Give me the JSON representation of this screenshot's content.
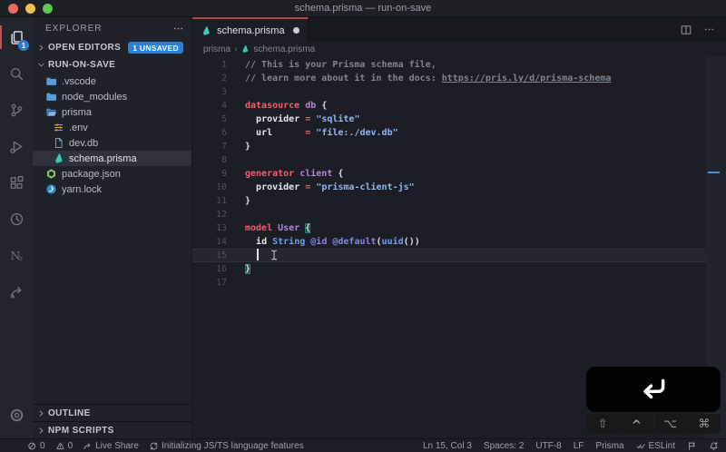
{
  "window": {
    "title": "schema.prisma — run-on-save"
  },
  "colors": {
    "tab_accent": "#b04a40",
    "activity_indicator": "#c94f44",
    "badge_blue": "#2b7fd4",
    "prisma_teal": "#3ec9b7",
    "folder_blue": "#559ddb",
    "node_green": "#8cc265",
    "yarn_blue": "#2d8ebf",
    "env_gold": "#d2a53a",
    "cursor_marker_blue": "#4f8ed4",
    "editor_bg": "#1b1e24",
    "sidebar_bg": "#1f2228",
    "statusbar_bg": "#1c1f25"
  },
  "activity_bar": {
    "items": [
      {
        "name": "explorer",
        "active": true,
        "badge": "1"
      },
      {
        "name": "search"
      },
      {
        "name": "source-control"
      },
      {
        "name": "run-debug"
      },
      {
        "name": "extensions"
      },
      {
        "name": "history-clock"
      },
      {
        "name": "n2"
      },
      {
        "name": "share-arrow"
      }
    ],
    "bottom": [
      {
        "name": "settings-gear"
      }
    ]
  },
  "sidebar": {
    "title": "EXPLORER",
    "open_editors": {
      "label": "OPEN EDITORS",
      "badge": "1 UNSAVED"
    },
    "section": "RUN-ON-SAVE",
    "files": [
      {
        "icon": "folder",
        "label": ".vscode",
        "depth": 1
      },
      {
        "icon": "folder",
        "label": "node_modules",
        "depth": 1
      },
      {
        "icon": "folder-open",
        "label": "prisma",
        "depth": 1
      },
      {
        "icon": "env",
        "label": ".env",
        "depth": 2
      },
      {
        "icon": "file",
        "label": "dev.db",
        "depth": 2
      },
      {
        "icon": "prisma",
        "label": "schema.prisma",
        "depth": 2,
        "selected": true
      },
      {
        "icon": "node",
        "label": "package.json",
        "depth": 1
      },
      {
        "icon": "yarn",
        "label": "yarn.lock",
        "depth": 1
      }
    ],
    "outline_label": "OUTLINE",
    "npm_label": "NPM SCRIPTS"
  },
  "editor": {
    "tab": {
      "name": "schema.prisma",
      "modified": true
    },
    "breadcrumb": {
      "folder": "prisma",
      "file": "schema.prisma"
    },
    "cursor": {
      "line": 15,
      "col": 3
    },
    "code": {
      "lines": [
        {
          "n": "1",
          "tokens": [
            [
              "com",
              "// This is your Prisma schema file,"
            ]
          ]
        },
        {
          "n": "2",
          "tokens": [
            [
              "com",
              "// learn more about it in the docs: "
            ],
            [
              "com-link",
              "https://pris.ly/d/prisma-schema"
            ]
          ]
        },
        {
          "n": "3",
          "tokens": []
        },
        {
          "n": "4",
          "tokens": [
            [
              "kw",
              "datasource"
            ],
            [
              "pln",
              " "
            ],
            [
              "ent",
              "db"
            ],
            [
              "pln",
              " {"
            ]
          ]
        },
        {
          "n": "5",
          "tokens": [
            [
              "pln",
              "  "
            ],
            [
              "prop",
              "provider"
            ],
            [
              "pln",
              " "
            ],
            [
              "op",
              "="
            ],
            [
              "pln",
              " "
            ],
            [
              "str",
              "\"sqlite\""
            ]
          ]
        },
        {
          "n": "6",
          "tokens": [
            [
              "pln",
              "  "
            ],
            [
              "prop",
              "url"
            ],
            [
              "pln",
              "      "
            ],
            [
              "op",
              "="
            ],
            [
              "pln",
              " "
            ],
            [
              "str",
              "\"file:./dev.db\""
            ]
          ]
        },
        {
          "n": "7",
          "tokens": [
            [
              "pln",
              "}"
            ]
          ]
        },
        {
          "n": "8",
          "tokens": []
        },
        {
          "n": "9",
          "tokens": [
            [
              "kw",
              "generator"
            ],
            [
              "pln",
              " "
            ],
            [
              "ent",
              "client"
            ],
            [
              "pln",
              " {"
            ]
          ]
        },
        {
          "n": "10",
          "tokens": [
            [
              "pln",
              "  "
            ],
            [
              "prop",
              "provider"
            ],
            [
              "pln",
              " "
            ],
            [
              "op",
              "="
            ],
            [
              "pln",
              " "
            ],
            [
              "str",
              "\"prisma-client-js\""
            ]
          ]
        },
        {
          "n": "11",
          "tokens": [
            [
              "pln",
              "}"
            ]
          ]
        },
        {
          "n": "12",
          "tokens": []
        },
        {
          "n": "13",
          "tokens": [
            [
              "kw",
              "model"
            ],
            [
              "pln",
              " "
            ],
            [
              "ent",
              "User"
            ],
            [
              "pln",
              " "
            ],
            [
              "match",
              "{"
            ]
          ]
        },
        {
          "n": "14",
          "tokens": [
            [
              "pln",
              "  "
            ],
            [
              "prop",
              "id"
            ],
            [
              "pln",
              " "
            ],
            [
              "type",
              "String"
            ],
            [
              "pln",
              " "
            ],
            [
              "attr",
              "@id"
            ],
            [
              "pln",
              " "
            ],
            [
              "attr",
              "@default"
            ],
            [
              "pln",
              "("
            ],
            [
              "type",
              "uuid"
            ],
            [
              "pln",
              "())"
            ]
          ]
        },
        {
          "n": "15",
          "tokens": [
            [
              "pln",
              "  "
            ]
          ],
          "cursor": true
        },
        {
          "n": "16",
          "tokens": [
            [
              "match",
              "}"
            ]
          ]
        },
        {
          "n": "17",
          "tokens": []
        }
      ]
    },
    "tab_actions": [
      {
        "name": "split-editor"
      },
      {
        "name": "more-actions"
      }
    ]
  },
  "keycast": {
    "pressed_key": "return",
    "modifiers": [
      {
        "name": "shift",
        "glyph": "⇧"
      },
      {
        "name": "control",
        "glyph": "^"
      },
      {
        "name": "option",
        "glyph": "⌥"
      },
      {
        "name": "command",
        "glyph": "⌘"
      }
    ]
  },
  "status_bar": {
    "left": [
      {
        "icon": "error-circle",
        "text": "0"
      },
      {
        "icon": "warning-triangle",
        "text": "0"
      },
      {
        "icon": "live-share",
        "text": "Live Share"
      },
      {
        "icon": "sync",
        "text": "Initializing JS/TS language features"
      }
    ],
    "right": [
      {
        "text": "Ln 15, Col 3"
      },
      {
        "text": "Spaces: 2"
      },
      {
        "text": "UTF-8"
      },
      {
        "text": "LF"
      },
      {
        "text": "Prisma"
      },
      {
        "icon": "eslint-check",
        "text": "ESLint"
      },
      {
        "icon": "feedback"
      },
      {
        "icon": "bell"
      }
    ]
  }
}
